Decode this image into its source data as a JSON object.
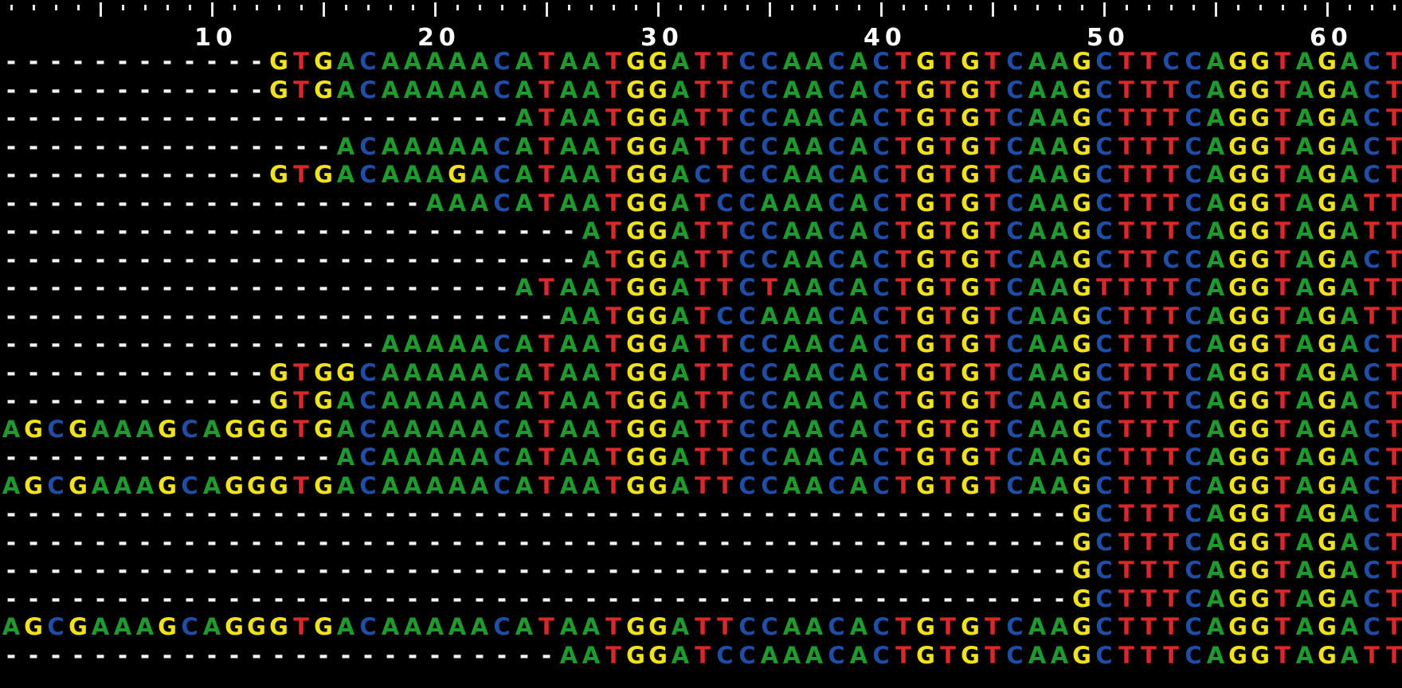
{
  "ruler": {
    "labels": [
      "10",
      "20",
      "30",
      "40",
      "50",
      "60"
    ],
    "label_positions": [
      10,
      20,
      30,
      40,
      50,
      60
    ]
  },
  "colors": {
    "background": "#000000",
    "A": "#1f9a2e",
    "C": "#1f4ea8",
    "G": "#f1e21c",
    "T": "#d8282a",
    "gap": "#f2f2f2",
    "ruler": "#e8e8e8"
  },
  "sequences": [
    "------------GTGACAAAAACATAATGGATTCCAACACTGTGTCAAGCTTCCAGGTAGACT",
    "------------GTGACAAAAACATAATGGATTCCAACACTGTGTCAAGCTTTCAGGTAGACT",
    "-----------------------ATAATGGATTCCAACACTGTGTCAAGCTTTCAGGTAGACT",
    "---------------ACAAAAACATAATGGATTCCAACACTGTGTCAAGCTTTCAGGTAGACT",
    "------------GTGACAAAGACATAATGGACTCCAACACTGTGTCAAGCTTTCAGGTAGACT",
    "-------------------AAACATAATGGATCCAAACACTGTGTCAAGCTTTCAGGTAGATT",
    "--------------------------ATGGATTCCAACACTGTGTCAAGCTTTCAGGTAGATT",
    "--------------------------ATGGATTCCAACACTGTGTCAAGCTTCCAGGTAGACT",
    "-----------------------ATAATGGATTCTAACACTGTGTCAAGTTTTCAGGTAGATT",
    "-------------------------AATGGATCCAAACACTGTGTCAAGCTTTCAGGTAGATT",
    "-----------------AAAAACATAATGGATTCCAACACTGTGTCAAGCTTTCAGGTAGACT",
    "------------GTGGCAAAAACATAATGGATTCCAACACTGTGTCAAGCTTTCAGGTAGACT",
    "------------GTGACAAAAACATAATGGATTCCAACACTGTGTCAAGCTTTCAGGTAGACT",
    "AGCGAAAGCAGGGTGACAAAAACATAATGGATTCCAACACTGTGTCAAGCTTTCAGGTAGACT",
    "---------------ACAAAAACATAATGGATTCCAACACTGTGTCAAGCTTTCAGGTAGACT",
    "AGCGAAAGCAGGGTGACAAAAACATAATGGATTCCAACACTGTGTCAAGCTTTCAGGTAGACT",
    "------------------------------------------------GCTTTCAGGTAGACT",
    "------------------------------------------------GCTTTCAGGTAGACT",
    "------------------------------------------------GCTTTCAGGTAGACT",
    "------------------------------------------------GCTTTCAGGTAGACT",
    "AGCGAAAGCAGGGTGACAAAAACATAATGGATTCCAACACTGTGTCAAGCTTTCAGGTAGACT",
    "-------------------------AATGGATCCAAACACTGTGTCAAGCTTTCAGGTAGATT"
  ]
}
